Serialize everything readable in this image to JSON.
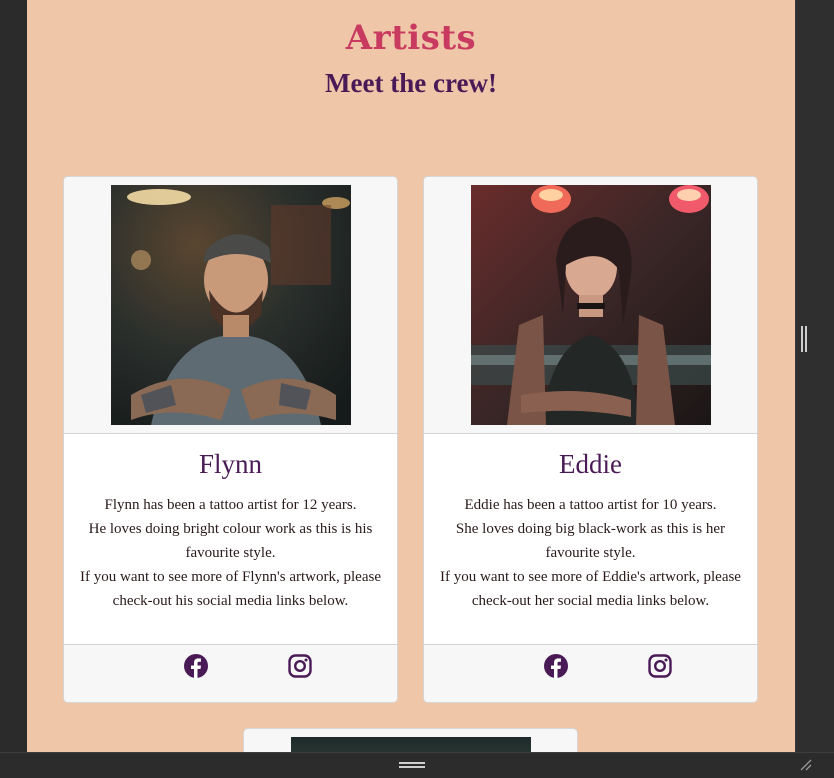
{
  "page": {
    "title": "Artists",
    "subtitle": "Meet the crew!"
  },
  "colors": {
    "background": "#f0c6a8",
    "title": "#c83a60",
    "accent": "#4a1a57"
  },
  "artists": [
    {
      "name": "Flynn",
      "photo_alt": "Flynn portrait",
      "lines": [
        "Flynn has been a tattoo artist for 12 years.",
        "He loves doing bright colour work as this is his favourite style.",
        "If you want to see more of Flynn's artwork, please check-out his social media links below."
      ],
      "social": [
        "facebook-icon",
        "instagram-icon"
      ]
    },
    {
      "name": "Eddie",
      "photo_alt": "Eddie portrait",
      "lines": [
        "Eddie has been a tattoo artist for 10 years.",
        "She loves doing big black-work as this is her favourite style.",
        "If you want to see more of Eddie's artwork, please check-out her social media links below."
      ],
      "social": [
        "facebook-icon",
        "instagram-icon"
      ]
    }
  ]
}
